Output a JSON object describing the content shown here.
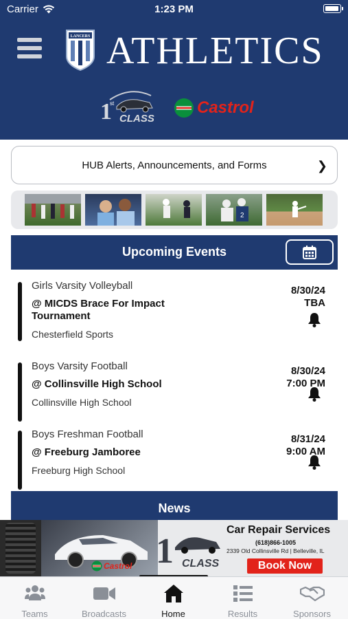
{
  "status": {
    "carrier": "Carrier",
    "time": "1:23 PM"
  },
  "header": {
    "title": "ATHLETICS",
    "crest_text": "LANCERS",
    "sponsor1_big": "1",
    "sponsor1_small": "st",
    "sponsor1_word": "CLASS",
    "sponsor2_name": "Castrol"
  },
  "hub": {
    "label": "HUB Alerts, Announcements, and Forms"
  },
  "events": {
    "title": "Upcoming Events",
    "items": [
      {
        "sport": "Girls Varsity Volleyball",
        "opponent": "@ MICDS Brace For Impact Tournament",
        "venue": "Chesterfield Sports",
        "date": "8/30/24",
        "time": "TBA"
      },
      {
        "sport": "Boys Varsity Football",
        "opponent": "@ Collinsville High School",
        "venue": "Collinsville High School",
        "date": "8/30/24",
        "time": "7:00 PM"
      },
      {
        "sport": "Boys Freshman Football",
        "opponent": "@ Freeburg Jamboree",
        "venue": "Freeburg High School",
        "date": "8/31/24",
        "time": "9:00 AM"
      }
    ]
  },
  "news": {
    "title": "News"
  },
  "ad": {
    "title": "Car Repair Services",
    "phone": "(618)866-1005",
    "address": "2339 Old Collinsville Rd | Belleville, IL",
    "cta": "Book Now",
    "brand": "Castrol"
  },
  "tabs": [
    {
      "label": "Teams",
      "icon": "people-icon"
    },
    {
      "label": "Broadcasts",
      "icon": "video-camera-icon"
    },
    {
      "label": "Home",
      "icon": "home-icon"
    },
    {
      "label": "Results",
      "icon": "list-icon"
    },
    {
      "label": "Sponsors",
      "icon": "handshake-icon"
    }
  ],
  "active_tab": "Home",
  "colors": {
    "navy": "#1f3a70",
    "red": "#e2231a",
    "castrol_green": "#0a8f3c"
  }
}
